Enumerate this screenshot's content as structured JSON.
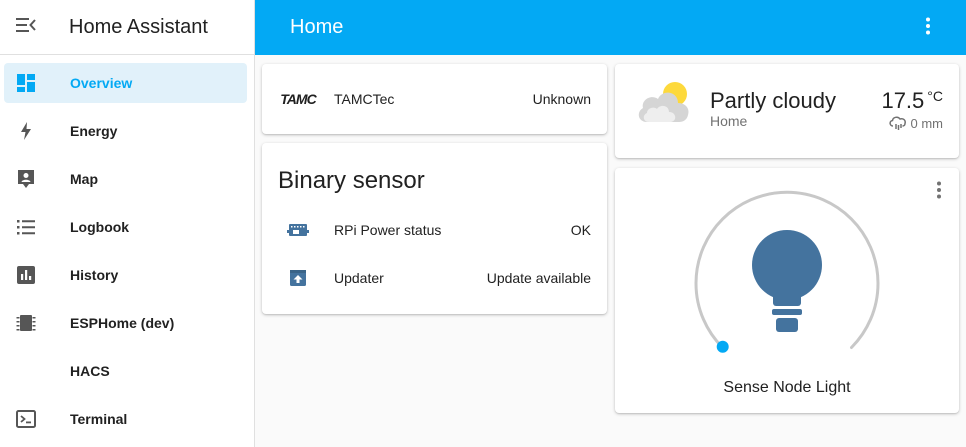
{
  "sidebar": {
    "title": "Home Assistant",
    "items": [
      {
        "label": "Overview",
        "icon": "dashboard-icon",
        "active": true
      },
      {
        "label": "Energy",
        "icon": "lightning-icon"
      },
      {
        "label": "Map",
        "icon": "map-person-icon"
      },
      {
        "label": "Logbook",
        "icon": "list-icon"
      },
      {
        "label": "History",
        "icon": "chart-box-icon"
      },
      {
        "label": "ESPHome (dev)",
        "icon": "chip-icon"
      },
      {
        "label": "HACS",
        "icon": "none"
      },
      {
        "label": "Terminal",
        "icon": "console-icon"
      }
    ]
  },
  "header": {
    "title": "Home"
  },
  "entity_card": {
    "rows": [
      {
        "name": "TAMCTec",
        "value": "Unknown",
        "logo_text": "TAMC",
        "icon": "tamc-logo-icon"
      }
    ]
  },
  "binary_card": {
    "title": "Binary sensor",
    "rows": [
      {
        "name": "RPi Power status",
        "value": "OK",
        "icon": "raspberry-pi-icon"
      },
      {
        "name": "Updater",
        "value": "Update available",
        "icon": "package-up-icon"
      }
    ]
  },
  "weather_card": {
    "condition": "Partly cloudy",
    "location": "Home",
    "temperature": "17.5",
    "unit": "°C",
    "precipitation": "0 mm"
  },
  "light_card": {
    "name": "Sense Node Light",
    "brightness_fraction": 0.0,
    "colors": {
      "bulb": "#44739e",
      "arc": "#c8c8c8",
      "handle": "#03a9f4"
    }
  },
  "colors": {
    "primary": "#03a9f4",
    "icon": "#44739e",
    "sidebar_icon": "#565656"
  }
}
